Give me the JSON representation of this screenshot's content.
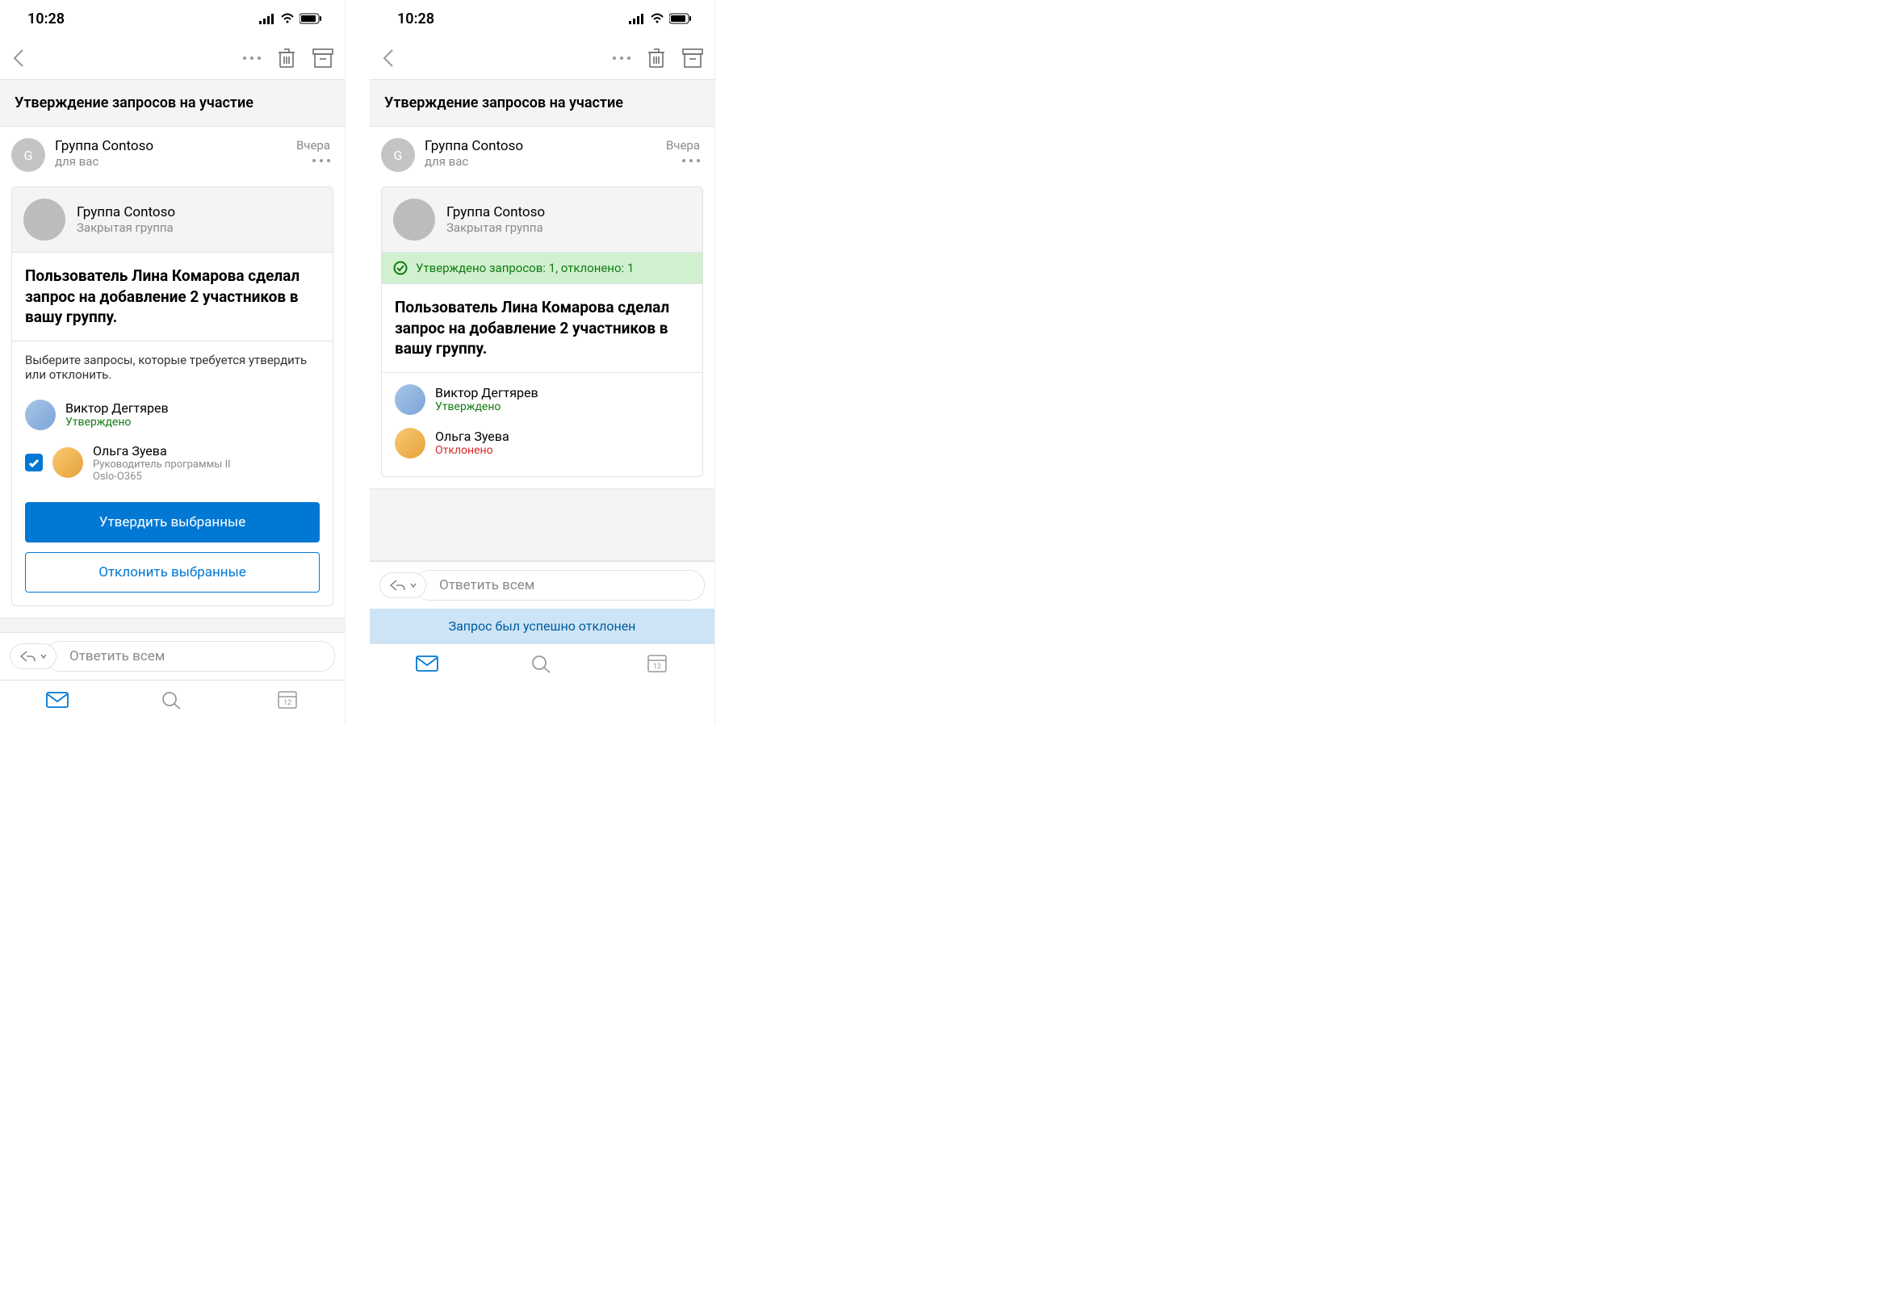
{
  "status": {
    "time": "10:28"
  },
  "subject": "Утверждение запросов на участие",
  "sender": {
    "avatar_letter": "G",
    "name": "Группа Contoso",
    "sub": "для вас",
    "timestamp": "Вчера"
  },
  "group": {
    "name": "Группа Contoso",
    "type": "Закрытая группа"
  },
  "banner": {
    "text": "Утверждено запросов: 1, отклонено: 1"
  },
  "body": {
    "headline": "Пользователь Лина Комарова сделал запрос на добавление 2 участников в вашу группу.",
    "instruction": "Выберите запросы, которые требуется утвердить или отклонить."
  },
  "people": {
    "p1": {
      "name": "Виктор Дегтярев",
      "status": "Утверждено"
    },
    "p2": {
      "name": "Ольга Зуева",
      "role": "Руководитель программы II",
      "team": "Oslo-O365",
      "status_rejected": "Отклонено"
    }
  },
  "buttons": {
    "approve": "Утвердить выбранные",
    "decline": "Отклонить выбранные"
  },
  "reply": {
    "placeholder": "Ответить всем"
  },
  "toast": {
    "text": "Запрос был успешно отклонен"
  },
  "calendar_day": "12"
}
